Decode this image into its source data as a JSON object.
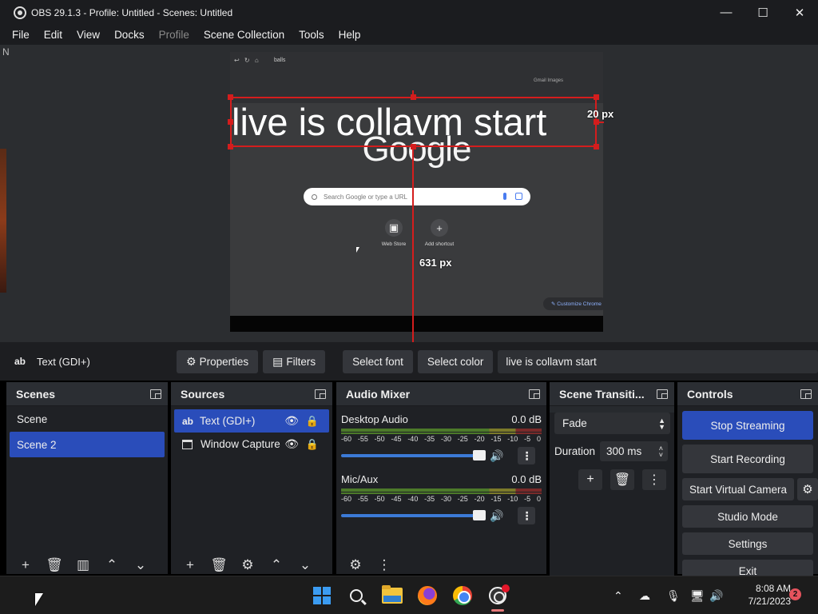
{
  "window": {
    "title": "OBS 29.1.3 - Profile: Untitled - Scenes: Untitled",
    "controls": {
      "minimize": "—",
      "maximize": "☐",
      "close": "✕"
    }
  },
  "menu": [
    "File",
    "Edit",
    "View",
    "Docks",
    "Profile",
    "Scene Collection",
    "Tools",
    "Help"
  ],
  "preview": {
    "side_letter": "N",
    "overlay_text": "live is collavm start",
    "width_label": "20 px",
    "height_label": "631 px",
    "captured": {
      "tab_text": "balls",
      "google_logo": "Google",
      "search_placeholder": "Search Google or type a URL",
      "gmail_hint": "Gmail  Images",
      "shortcut_1": "Web Store",
      "shortcut_2": "Add shortcut",
      "shortcut_2_icon": "+",
      "customize": "Customize Chrome"
    }
  },
  "source_toolbar": {
    "icon_text": "ab",
    "source_name": "Text (GDI+)",
    "properties": "Properties",
    "filters": "Filters",
    "select_font": "Select font",
    "select_color": "Select color",
    "text_value": "live is collavm start"
  },
  "scenes": {
    "title": "Scenes",
    "items": [
      "Scene",
      "Scene 2"
    ],
    "selected_index": 1
  },
  "sources": {
    "title": "Sources",
    "items": [
      {
        "icon": "ab",
        "name": "Text (GDI+)"
      },
      {
        "icon": "window",
        "name": "Window Capture"
      }
    ]
  },
  "audio_mixer": {
    "title": "Audio Mixer",
    "scale": [
      "-60",
      "-55",
      "-50",
      "-45",
      "-40",
      "-35",
      "-30",
      "-25",
      "-20",
      "-15",
      "-10",
      "-5",
      "0"
    ],
    "channels": [
      {
        "name": "Desktop Audio",
        "level": "0.0 dB",
        "volume": 1.0
      },
      {
        "name": "Mic/Aux",
        "level": "0.0 dB",
        "volume": 1.0
      }
    ]
  },
  "transitions": {
    "title": "Scene Transiti...",
    "selected": "Fade",
    "duration_label": "Duration",
    "duration_value": "300 ms"
  },
  "controls": {
    "title": "Controls",
    "stop_streaming": "Stop Streaming",
    "start_recording": "Start Recording",
    "start_virtual_camera": "Start Virtual Camera",
    "studio_mode": "Studio Mode",
    "settings": "Settings",
    "exit": "Exit"
  },
  "taskbar": {
    "time": "8:08 AM",
    "date": "7/21/2023",
    "notifications": "2"
  },
  "colors": {
    "accent": "#2a4dba",
    "selection": "#d41d1d",
    "panel": "#272a2e"
  }
}
